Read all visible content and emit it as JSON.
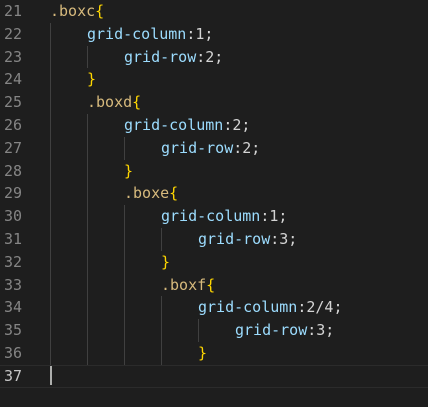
{
  "editor": {
    "theme_colors": {
      "background": "#1e1e1e",
      "line_number": "#858585",
      "selector": "#d7ba7d",
      "property": "#9cdcfe",
      "brace": "#ffd700",
      "punctuation": "#d4d4d4"
    },
    "lines": [
      {
        "number": "21",
        "tokens": [
          {
            "t": ".boxc",
            "c": "sel"
          },
          {
            "t": "{",
            "c": "brace"
          }
        ]
      },
      {
        "number": "22",
        "tokens": [
          {
            "t": "grid-column",
            "c": "prop"
          },
          {
            "t": ":1;",
            "c": "punct"
          }
        ]
      },
      {
        "number": "23",
        "tokens": [
          {
            "t": "grid-row",
            "c": "prop"
          },
          {
            "t": ":2;",
            "c": "punct"
          }
        ]
      },
      {
        "number": "24",
        "tokens": [
          {
            "t": "}",
            "c": "brace"
          }
        ]
      },
      {
        "number": "25",
        "tokens": [
          {
            "t": ".boxd",
            "c": "sel"
          },
          {
            "t": "{",
            "c": "brace"
          }
        ]
      },
      {
        "number": "26",
        "tokens": [
          {
            "t": "grid-column",
            "c": "prop"
          },
          {
            "t": ":2;",
            "c": "punct"
          }
        ]
      },
      {
        "number": "27",
        "tokens": [
          {
            "t": "grid-row",
            "c": "prop"
          },
          {
            "t": ":2;",
            "c": "punct"
          }
        ]
      },
      {
        "number": "28",
        "tokens": [
          {
            "t": "}",
            "c": "brace"
          }
        ]
      },
      {
        "number": "29",
        "tokens": [
          {
            "t": ".boxe",
            "c": "sel"
          },
          {
            "t": "{",
            "c": "brace"
          }
        ]
      },
      {
        "number": "30",
        "tokens": [
          {
            "t": "grid-column",
            "c": "prop"
          },
          {
            "t": ":1;",
            "c": "punct"
          }
        ]
      },
      {
        "number": "31",
        "tokens": [
          {
            "t": "grid-row",
            "c": "prop"
          },
          {
            "t": ":3;",
            "c": "punct"
          }
        ]
      },
      {
        "number": "32",
        "tokens": [
          {
            "t": "}",
            "c": "brace"
          }
        ]
      },
      {
        "number": "33",
        "tokens": [
          {
            "t": ".boxf",
            "c": "sel"
          },
          {
            "t": "{",
            "c": "brace"
          }
        ]
      },
      {
        "number": "34",
        "tokens": [
          {
            "t": "grid-column",
            "c": "prop"
          },
          {
            "t": ":2/4;",
            "c": "punct"
          }
        ]
      },
      {
        "number": "35",
        "tokens": [
          {
            "t": "grid-row",
            "c": "prop"
          },
          {
            "t": ":3;",
            "c": "punct"
          }
        ]
      },
      {
        "number": "36",
        "tokens": [
          {
            "t": "}",
            "c": "brace"
          }
        ]
      },
      {
        "number": "37",
        "tokens": []
      }
    ]
  }
}
